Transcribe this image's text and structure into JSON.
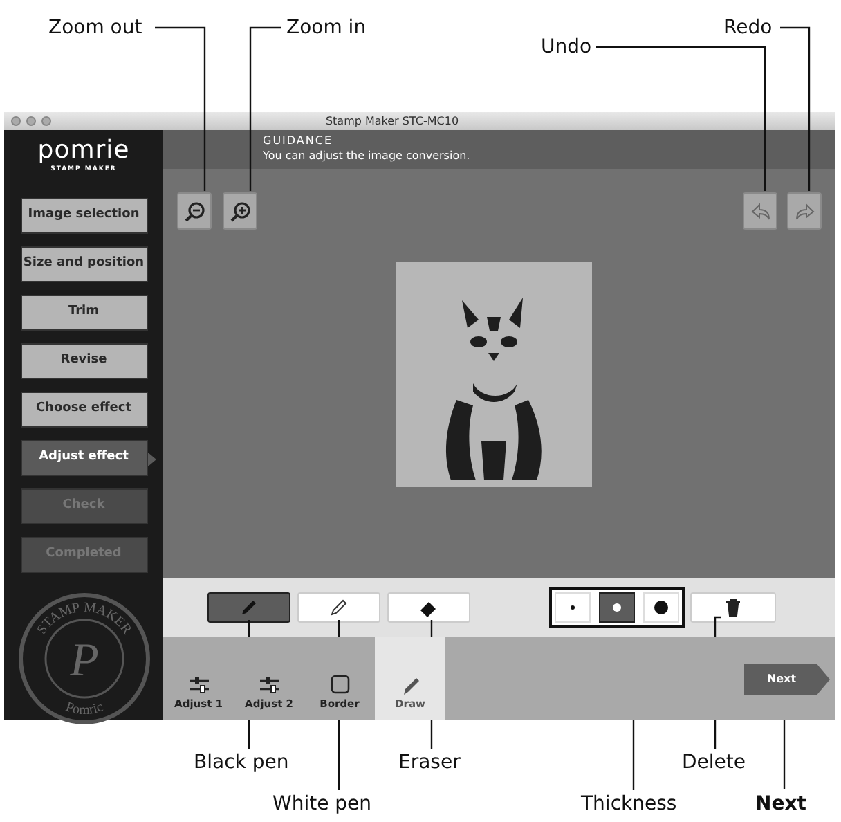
{
  "window": {
    "title": "Stamp Maker STC-MC10"
  },
  "sidebar": {
    "logo": "pomrie",
    "logo_sub": "STAMP MAKER",
    "steps": [
      {
        "label": "Image selection",
        "done": true,
        "current": false
      },
      {
        "label": "Size and position",
        "done": true,
        "current": false
      },
      {
        "label": "Trim",
        "done": true,
        "current": false
      },
      {
        "label": "Revise",
        "done": true,
        "current": false
      },
      {
        "label": "Choose effect",
        "done": true,
        "current": false
      },
      {
        "label": "Adjust effect",
        "done": false,
        "current": true
      },
      {
        "label": "Check",
        "done": false,
        "current": false
      },
      {
        "label": "Completed",
        "done": false,
        "current": false
      }
    ],
    "seal": {
      "top": "STAMP MAKER",
      "letter": "P",
      "bottom": "Pomric"
    }
  },
  "guidance": {
    "title": "GUIDANCE",
    "text": "You can adjust the image conversion."
  },
  "tools": [
    {
      "kind": "black-pen",
      "selected": true
    },
    {
      "kind": "white-pen",
      "selected": false
    },
    {
      "kind": "eraser",
      "selected": false
    }
  ],
  "thickness": [
    {
      "kind": "thin",
      "selected": false
    },
    {
      "kind": "medium",
      "selected": true
    },
    {
      "kind": "thick",
      "selected": false
    }
  ],
  "tabs": [
    {
      "label": "Adjust 1",
      "kind": "sliders",
      "selected": false
    },
    {
      "label": "Adjust 2",
      "kind": "sliders",
      "selected": false
    },
    {
      "label": "Border",
      "kind": "square",
      "selected": false
    },
    {
      "label": "Draw",
      "kind": "pencil",
      "selected": true
    }
  ],
  "next_button": "Next",
  "callouts": [
    {
      "label": "Zoom out",
      "bold": false
    },
    {
      "label": "Zoom in",
      "bold": false
    },
    {
      "label": "Undo",
      "bold": false
    },
    {
      "label": "Redo",
      "bold": false
    },
    {
      "label": "Black pen",
      "bold": false
    },
    {
      "label": "Eraser",
      "bold": false
    },
    {
      "label": "Delete",
      "bold": false
    },
    {
      "label": "White pen",
      "bold": false
    },
    {
      "label": "Thickness",
      "bold": false
    },
    {
      "label": "Next",
      "bold": true
    }
  ]
}
